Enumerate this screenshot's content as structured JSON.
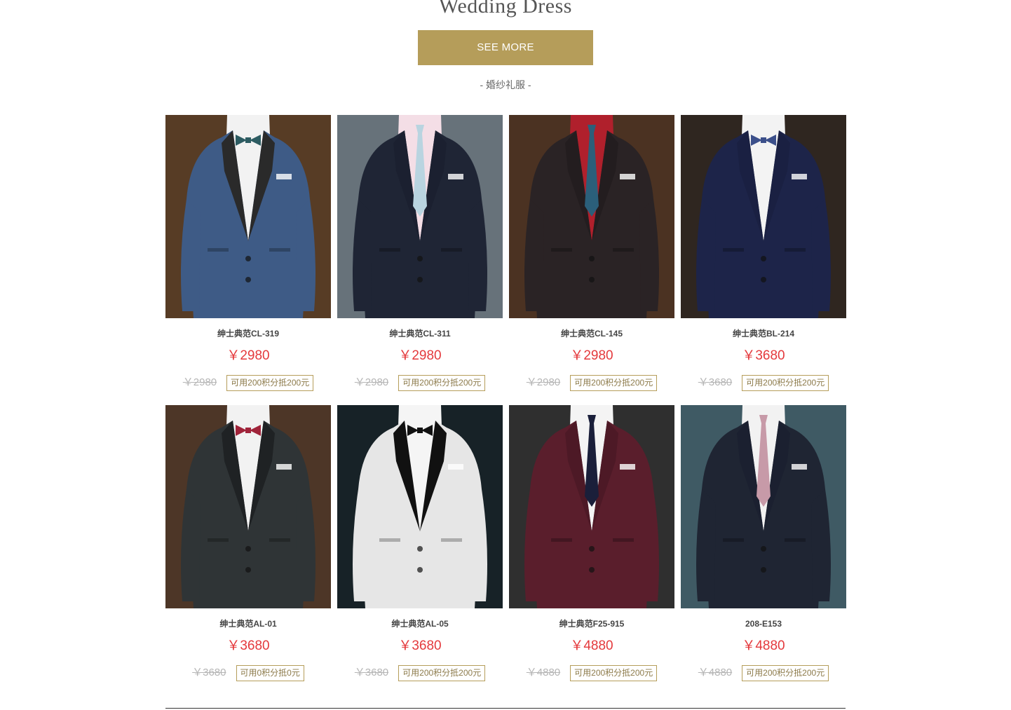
{
  "section": {
    "title": "Wedding Dress",
    "see_more_label": "SEE MORE",
    "subtitle": "- 婚纱礼服 -"
  },
  "products": [
    {
      "name": "绅士典范CL-319",
      "price": "￥2980",
      "old_price": "￥2980",
      "points": "可用200积分抵200元",
      "jacket": "#3e5b86",
      "lapel": "#2a2a2a",
      "bg": "#6b4a2e",
      "shirt": "#f2f2f2",
      "tie": "#2d5c62",
      "tie_icon": "bowtie-icon"
    },
    {
      "name": "绅士典范CL-311",
      "price": "￥2980",
      "old_price": "￥2980",
      "points": "可用200积分抵200元",
      "jacket": "#1f2535",
      "lapel": "#1b2030",
      "bg": "#7e8c95",
      "shirt": "#f4dee6",
      "tie": "#b9d4e0",
      "tie_icon": "necktie-icon"
    },
    {
      "name": "绅士典范CL-145",
      "price": "￥2980",
      "old_price": "￥2980",
      "points": "可用200积分抵200元",
      "jacket": "#2a2325",
      "lapel": "#231d1f",
      "bg": "#5c3d2a",
      "shirt": "#b0202c",
      "tie": "#2b5f7a",
      "tie_icon": "necktie-icon"
    },
    {
      "name": "绅士典范BL-214",
      "price": "￥3680",
      "old_price": "￥3680",
      "points": "可用200积分抵200元",
      "jacket": "#1d2449",
      "lapel": "#1a2042",
      "bg": "#3a2f28",
      "shirt": "#f3f3f3",
      "tie": "#3b4f8a",
      "tie_icon": "bowtie-icon"
    },
    {
      "name": "绅士典范AL-01",
      "price": "￥3680",
      "old_price": "￥3680",
      "points": "可用0积分抵0元",
      "jacket": "#2f3436",
      "lapel": "#1f2224",
      "bg": "#5e4330",
      "shirt": "#f2f2f2",
      "tie": "#a0243a",
      "tie_icon": "bowtie-icon"
    },
    {
      "name": "绅士典范AL-05",
      "price": "￥3680",
      "old_price": "￥3680",
      "points": "可用200积分抵200元",
      "jacket": "#e6e6e6",
      "lapel": "#111111",
      "bg": "#1d2a30",
      "shirt": "#f5f5f5",
      "tie": "#111111",
      "tie_icon": "bowtie-icon"
    },
    {
      "name": "绅士典范F25-915",
      "price": "￥4880",
      "old_price": "￥4880",
      "points": "可用200积分抵200元",
      "jacket": "#5a1e2c",
      "lapel": "#4d1926",
      "bg": "#3a3a3a",
      "shirt": "#f4f4f4",
      "tie": "#1a1f3a",
      "tie_icon": "necktie-icon"
    },
    {
      "name": "208-E153",
      "price": "￥4880",
      "old_price": "￥4880",
      "points": "可用200积分抵200元",
      "jacket": "#1f2533",
      "lapel": "#1b2030",
      "bg": "#4e6e7a",
      "shirt": "#f2f2f2",
      "tie": "#c79aa8",
      "tie_icon": "necktie-icon"
    }
  ]
}
